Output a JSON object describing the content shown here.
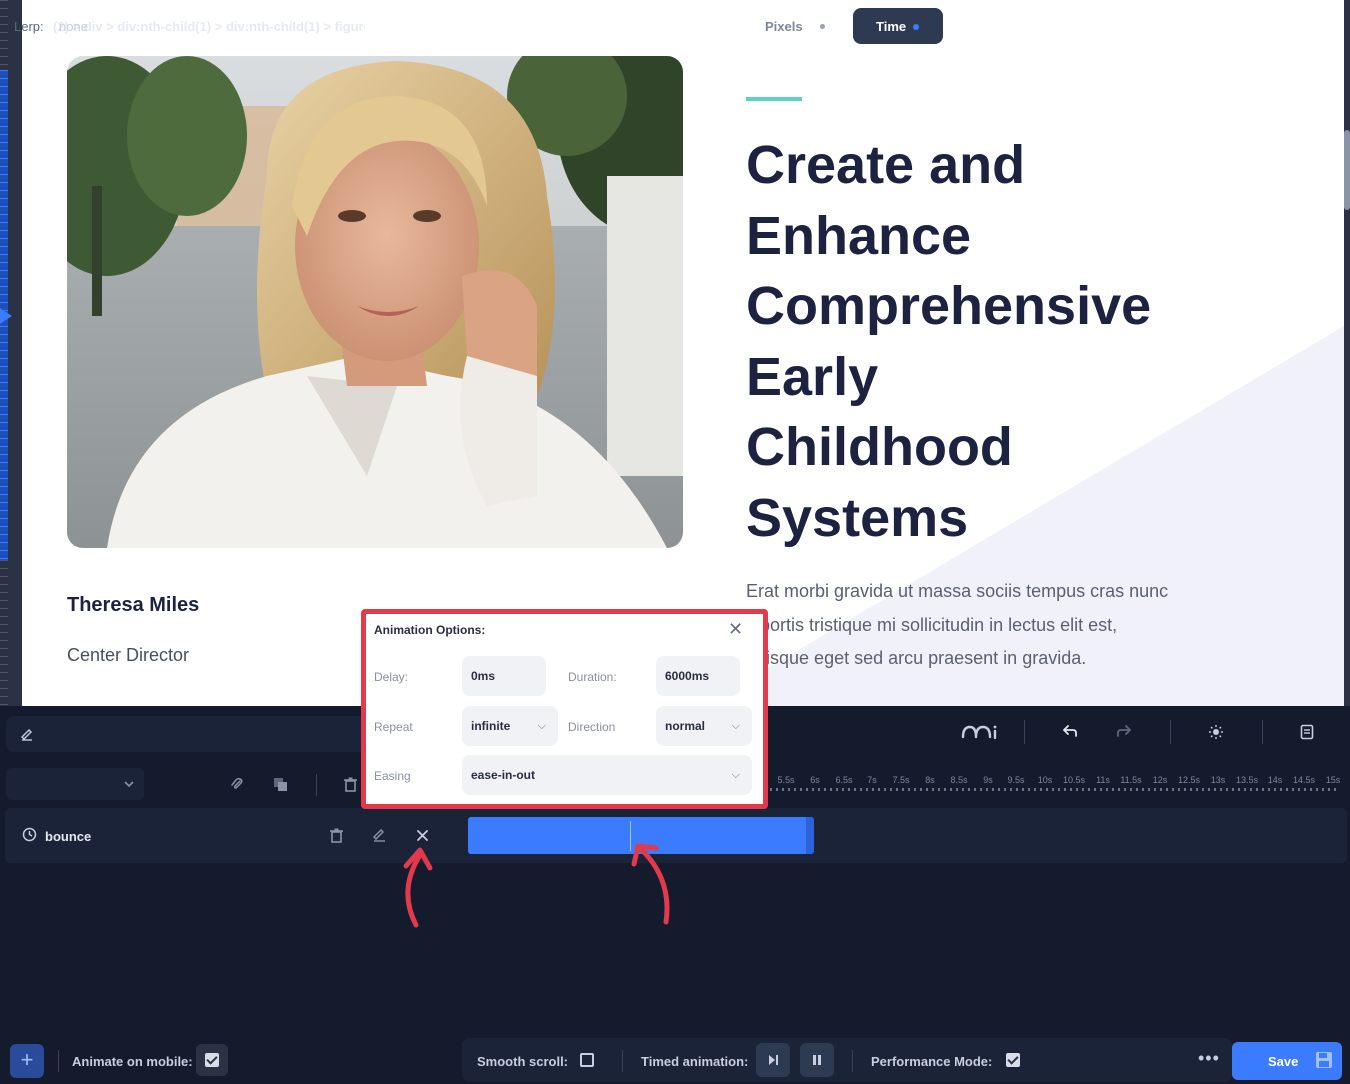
{
  "canvas": {
    "author": {
      "name": "Theresa Miles",
      "role": "Center Director"
    },
    "headline_lines": [
      "Create and",
      "Enhance",
      "Comprehensive",
      "Early",
      "Childhood",
      "Systems"
    ],
    "body_lines": [
      "Erat morbi gravida ut massa sociis tempus cras nunc",
      "lobortis tristique mi sollicitudin in lectus elit est,",
      "quisque eget sed arcu praesent in gravida."
    ]
  },
  "toolbar": {
    "breadcrumb": "(2) > div > div:nth-child(1) > div:nth-child(1) > figure",
    "pixels_label": "Pixels",
    "time_label": "Time"
  },
  "timeline": {
    "lerp_label": "Lerp:",
    "lerp_value": "none",
    "ticks": [
      "5.5s",
      "6s",
      "6.5s",
      "7s",
      "7.5s",
      "8s",
      "8.5s",
      "9s",
      "9.5s",
      "10s",
      "10.5s",
      "11s",
      "11.5s",
      "12s",
      "12.5s",
      "13s",
      "13.5s",
      "14s",
      "14.5s",
      "15s"
    ],
    "track_name": "bounce"
  },
  "animation_options": {
    "title": "Animation Options:",
    "delay_label": "Delay:",
    "delay_value": "0ms",
    "duration_label": "Duration:",
    "duration_value": "6000ms",
    "repeat_label": "Repeat",
    "repeat_value": "infinite",
    "direction_label": "Direction",
    "direction_value": "normal",
    "easing_label": "Easing",
    "easing_value": "ease-in-out"
  },
  "bottom_bar": {
    "animate_on_mobile_label": "Animate on mobile:",
    "animate_on_mobile_checked": true,
    "smooth_scroll_label": "Smooth scroll:",
    "smooth_scroll_checked": false,
    "timed_animation_label": "Timed animation:",
    "performance_mode_label": "Performance Mode:",
    "performance_mode_checked": true,
    "save_label": "Save"
  },
  "colors": {
    "accent": "#3b7bff",
    "annotation_red": "#e23a4a",
    "heading": "#1c2240",
    "teal_accent": "#5ed0c8"
  }
}
